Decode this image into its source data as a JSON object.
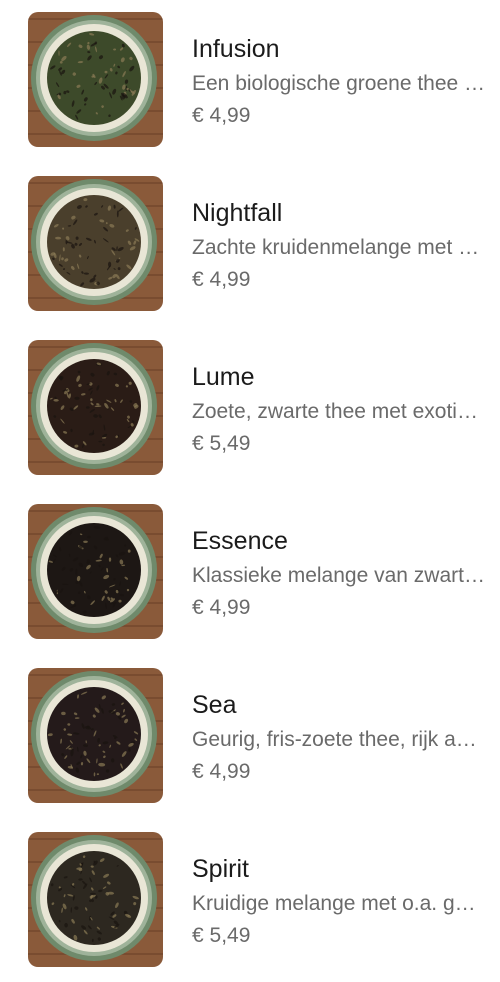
{
  "products": [
    {
      "name": "Infusion",
      "description": "Een biologische groene thee met een fijne smaak",
      "price": "€ 4,99",
      "image": "green-tea-bowl-image",
      "tea_color": "#3d4a2a"
    },
    {
      "name": "Nightfall",
      "description": "Zachte kruidenmelange met bloesem",
      "price": "€ 4,99",
      "image": "herbal-blend-bowl-image",
      "tea_color": "#4a3f2c"
    },
    {
      "name": "Lume",
      "description": "Zoete, zwarte thee met exotische vruchten",
      "price": "€ 5,49",
      "image": "black-fruit-tea-bowl-image",
      "tea_color": "#2a1c16"
    },
    {
      "name": "Essence",
      "description": "Klassieke melange van zwarte thee",
      "price": "€ 4,99",
      "image": "black-tea-bowl-image",
      "tea_color": "#1d1714"
    },
    {
      "name": "Sea",
      "description": "Geurig, fris-zoete thee, rijk aan bloemen",
      "price": "€ 4,99",
      "image": "floral-tea-bowl-image",
      "tea_color": "#241a1a"
    },
    {
      "name": "Spirit",
      "description": "Kruidige melange met o.a. gember",
      "price": "€ 5,49",
      "image": "spiced-tea-bowl-image",
      "tea_color": "#2d2820"
    }
  ]
}
